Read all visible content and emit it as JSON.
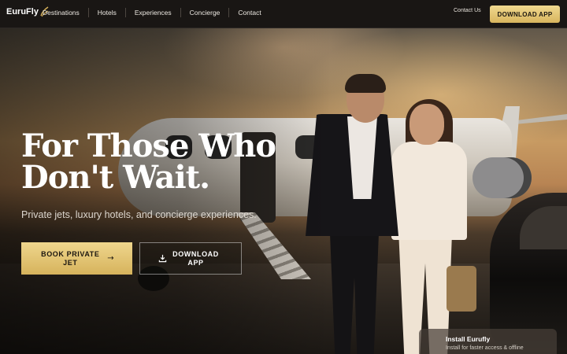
{
  "nav": {
    "logo_text": "EuruFly",
    "links": [
      "Destinations",
      "Hotels",
      "Experiences",
      "Concierge",
      "Contact"
    ],
    "contact_us": "Contact Us",
    "cta_label": "DOWNLOAD APP"
  },
  "hero": {
    "headline": "For Those Who Don't Wait.",
    "subline": "Private jets, luxury hotels, and concierge experiences.",
    "primary_button": "BOOK PRIVATE JET",
    "primary_icon": "arrow-right-icon",
    "secondary_button": "DOWNLOAD APP",
    "secondary_icon": "download-icon"
  },
  "install_prompt": {
    "title": "Install Eurufly",
    "subtitle": "Install for faster access & offline"
  },
  "colors": {
    "gold": "#e3c472",
    "nav_bg": "#191614",
    "text_light": "#ffffff"
  }
}
